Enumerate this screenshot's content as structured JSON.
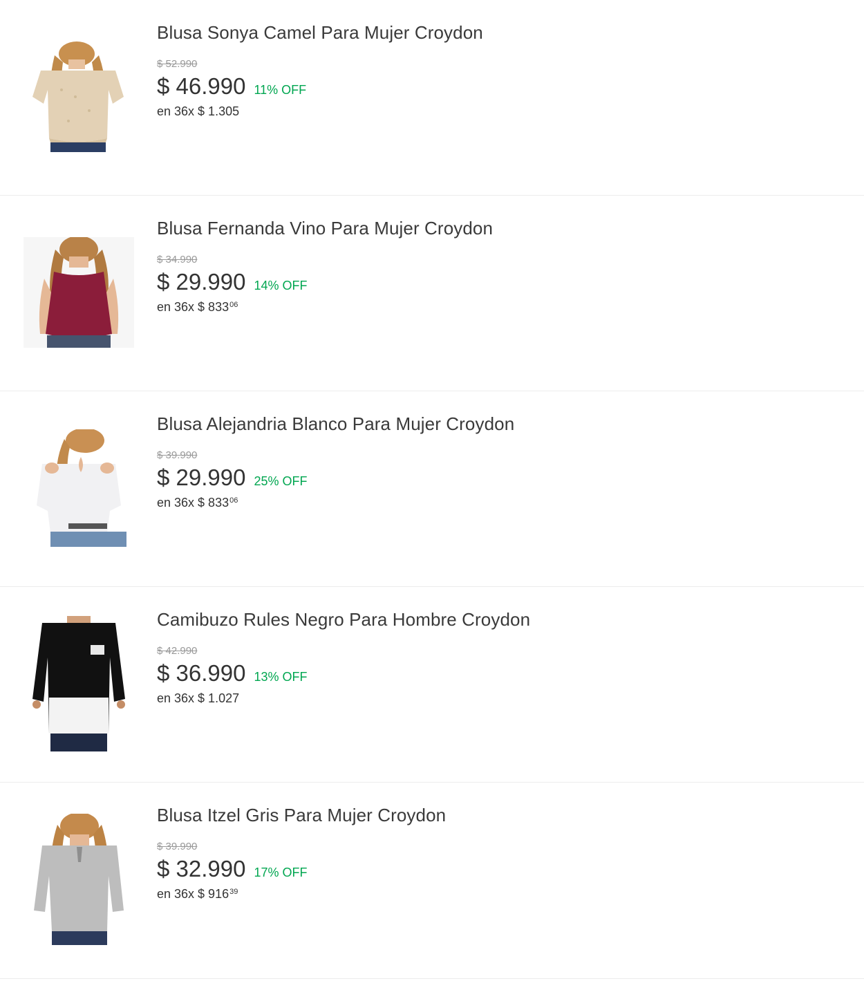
{
  "colors": {
    "discount": "#00a650",
    "old_price": "#999999",
    "text": "#333333",
    "divider": "#ececec"
  },
  "products": [
    {
      "title": "Blusa Sonya Camel Para Mujer Croydon",
      "old_price": "$ 52.990",
      "price": "$ 46.990",
      "discount": "11% OFF",
      "installments_prefix": "en 36x $ 1.305",
      "installments_cents": "",
      "image_icon": "camel-lace-blouse-image"
    },
    {
      "title": "Blusa Fernanda Vino Para Mujer Croydon",
      "old_price": "$ 34.990",
      "price": "$ 29.990",
      "discount": "14% OFF",
      "installments_prefix": "en 36x $ 833",
      "installments_cents": "06",
      "image_icon": "wine-tank-blouse-image"
    },
    {
      "title": "Blusa Alejandria Blanco Para Mujer Croydon",
      "old_price": "$ 39.990",
      "price": "$ 29.990",
      "discount": "25% OFF",
      "installments_prefix": "en 36x $ 833",
      "installments_cents": "06",
      "image_icon": "white-cold-shoulder-blouse-image"
    },
    {
      "title": "Camibuzo Rules Negro Para Hombre Croydon",
      "old_price": "$ 42.990",
      "price": "$ 36.990",
      "discount": "13% OFF",
      "installments_prefix": "en 36x $ 1.027",
      "installments_cents": "",
      "image_icon": "black-white-longsleeve-shirt-image"
    },
    {
      "title": "Blusa Itzel Gris Para Mujer Croydon",
      "old_price": "$ 39.990",
      "price": "$ 32.990",
      "discount": "17% OFF",
      "installments_prefix": "en 36x $ 916",
      "installments_cents": "39",
      "image_icon": "gray-tie-neck-blouse-image"
    }
  ]
}
